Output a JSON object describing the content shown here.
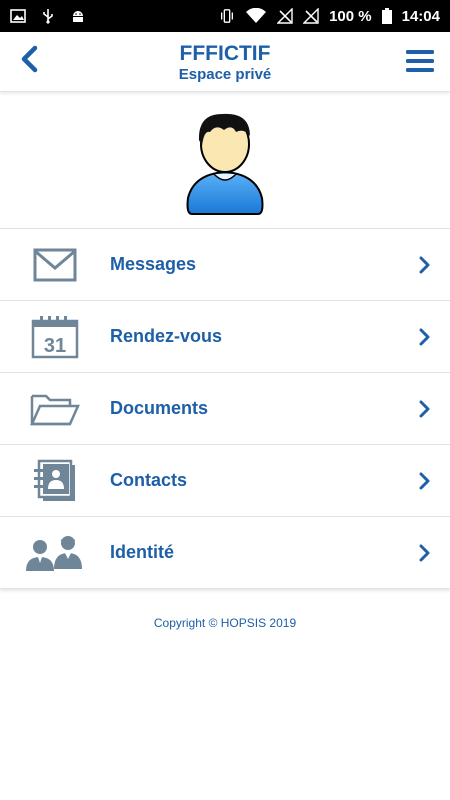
{
  "status_bar": {
    "battery": "100 %",
    "time": "14:04",
    "icons": [
      "image-icon",
      "usb-icon",
      "android-icon",
      "vibrate-icon",
      "wifi-icon",
      "no-signal-icon",
      "no-signal-icon",
      "battery-icon"
    ]
  },
  "header": {
    "title": "FFFICTIF",
    "subtitle": "Espace privé",
    "back_icon": "chevron-left-icon",
    "menu_icon": "hamburger-menu-icon"
  },
  "menu": {
    "items": [
      {
        "label": "Messages",
        "icon": "envelope-icon"
      },
      {
        "label": "Rendez-vous",
        "icon": "calendar-icon",
        "calendar_day": "31"
      },
      {
        "label": "Documents",
        "icon": "folder-icon"
      },
      {
        "label": "Contacts",
        "icon": "address-book-icon"
      },
      {
        "label": "Identité",
        "icon": "people-icon"
      }
    ]
  },
  "footer": {
    "copyright": "Copyright © HOPSIS 2019"
  },
  "colors": {
    "accent": "#1d5fa8",
    "icon_gray": "#6f8698",
    "avatar_blue": "#2a8fe6",
    "status_bar": "#000000"
  }
}
